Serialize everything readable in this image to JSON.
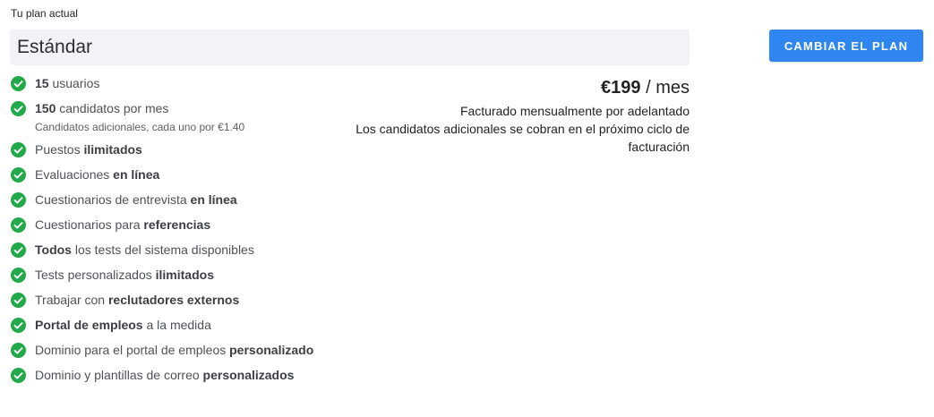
{
  "header": {
    "current_plan_label": "Tu plan actual",
    "plan_name": "Estándar",
    "change_button": "CAMBIAR EL PLAN"
  },
  "features": [
    {
      "pre": "",
      "bold": "15",
      "post": " usuarios",
      "note": ""
    },
    {
      "pre": "",
      "bold": "150",
      "post": " candidatos por mes",
      "note": "Candidatos adicionales, cada uno por €1.40"
    },
    {
      "pre": "Puestos ",
      "bold": "ilimitados",
      "post": "",
      "note": ""
    },
    {
      "pre": "Evaluaciones ",
      "bold": "en línea",
      "post": "",
      "note": ""
    },
    {
      "pre": "Cuestionarios de entrevista ",
      "bold": "en línea",
      "post": "",
      "note": ""
    },
    {
      "pre": "Cuestionarios para ",
      "bold": "referencias",
      "post": "",
      "note": ""
    },
    {
      "pre": "",
      "bold": "Todos",
      "post": " los tests del sistema disponibles",
      "note": ""
    },
    {
      "pre": "Tests personalizados ",
      "bold": "ilimitados",
      "post": "",
      "note": ""
    },
    {
      "pre": "Trabajar con ",
      "bold": "reclutadores externos",
      "post": "",
      "note": ""
    },
    {
      "pre": "",
      "bold": "Portal de empleos",
      "post": " a la medida",
      "note": ""
    },
    {
      "pre": "Dominio para el portal de empleos ",
      "bold": "personalizado",
      "post": "",
      "note": ""
    },
    {
      "pre": "Dominio y plantillas de correo ",
      "bold": "personalizados",
      "post": "",
      "note": ""
    }
  ],
  "pricing": {
    "amount": "€199",
    "period": " / mes",
    "billing_line_1": "Facturado mensualmente por adelantado",
    "billing_line_2": "Los candidatos adicionales se cobran en el próximo ciclo de facturación"
  },
  "colors": {
    "check": "#21a94a",
    "button": "#2f86f0",
    "plan_box": "#f1f3f7"
  },
  "icons": {
    "feature": "check-circle-icon"
  }
}
